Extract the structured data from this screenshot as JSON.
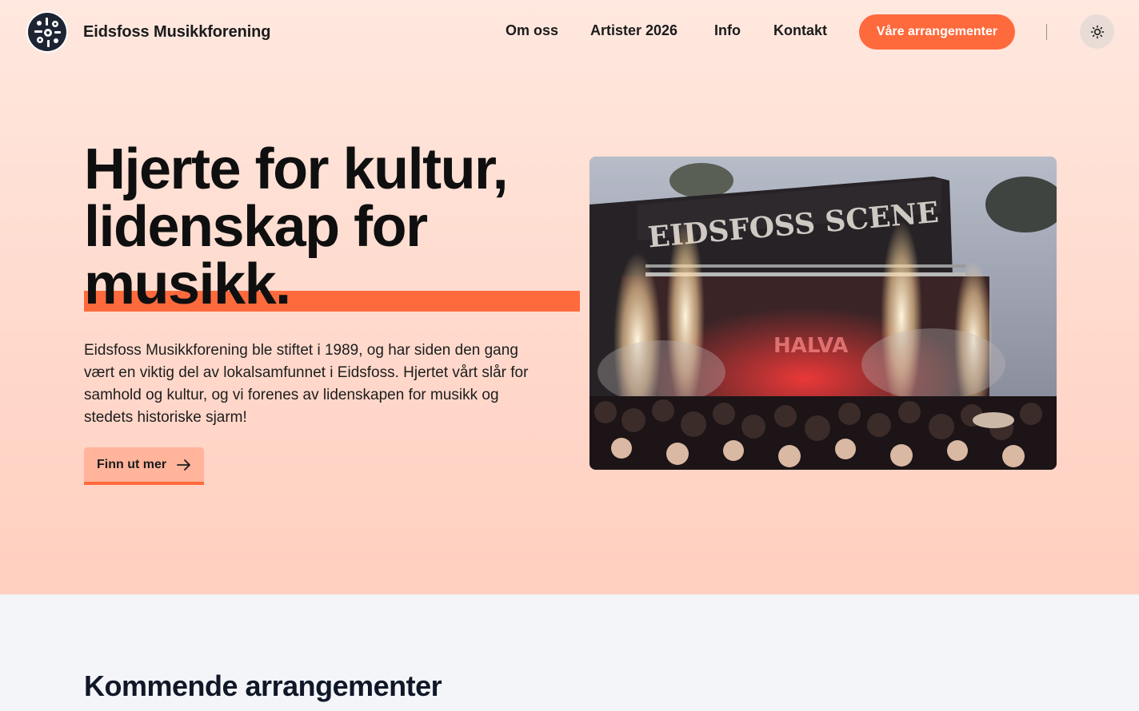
{
  "header": {
    "brand": "Eidsfoss Musikkforening",
    "nav": [
      {
        "label": "Om oss"
      },
      {
        "label": "Artister 2026"
      },
      {
        "label": "Info"
      },
      {
        "label": "Kontakt"
      }
    ],
    "cta_label": "Våre arrangementer",
    "logo_icon": "musical-instruments-logo",
    "theme_icon": "sun-icon"
  },
  "hero": {
    "title_line1": "Hjerte for kultur,",
    "title_line2": "lidenskap for",
    "title_line3": "musikk.",
    "description": "Eidsfoss Musikkforening ble stiftet i 1989, og har siden den gang vært en viktig del av lokalsamfunnet i Eidsfoss. Hjertet vårt slår for samhold og kultur, og vi forenes av lidenskapen for musikk og stedets historiske sjarm!",
    "button_label": "Finn ut mer",
    "button_icon": "arrow-right-icon",
    "image": {
      "stage_banner": "EIDSFOSS SCENE",
      "backdrop_text": "HALVA"
    }
  },
  "events": {
    "title": "Kommende arrangementer"
  },
  "colors": {
    "accent": "#ff6a3d",
    "hero_bg_top": "#ffe8df",
    "hero_bg_bottom": "#ffcfbf",
    "section_bg": "#f3f5f9"
  }
}
